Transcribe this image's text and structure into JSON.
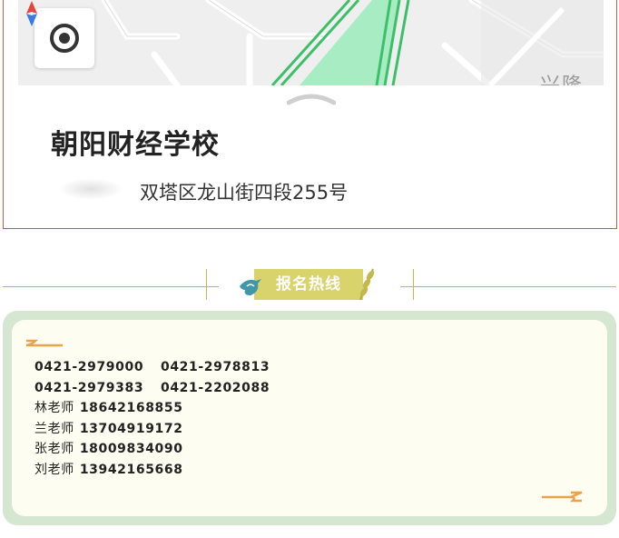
{
  "map": {
    "place_name": "朝阳财经学校",
    "address": "双塔区龙山街四段255号",
    "map_label": "兴隆"
  },
  "section": {
    "title": "报名热线"
  },
  "hotline": {
    "phone_pairs": [
      [
        "0421-2979000",
        "0421-2978813"
      ],
      [
        "0421-2979383",
        "0421-2202088"
      ]
    ],
    "teachers": [
      {
        "name": "林老师",
        "phone": "18642168855"
      },
      {
        "name": "兰老师",
        "phone": "13704919172"
      },
      {
        "name": "张老师",
        "phone": "18009834090"
      },
      {
        "name": "刘老师",
        "phone": "13942165668"
      }
    ]
  },
  "colors": {
    "card_border": "#b9604a",
    "road_green": "#3dbf6a",
    "park_green": "#a8ecc4",
    "title_badge": "#d8d36a",
    "rule_gold": "#c2b94d",
    "frame_green": "#d5e7d1",
    "panel_bg": "#fdfdf2",
    "accent_orange": "#e8a44a"
  },
  "icons": [
    "locate-icon",
    "compass-icon",
    "chevron-up-icon",
    "location-pin-icon",
    "bird-icon",
    "leaf-icon"
  ]
}
